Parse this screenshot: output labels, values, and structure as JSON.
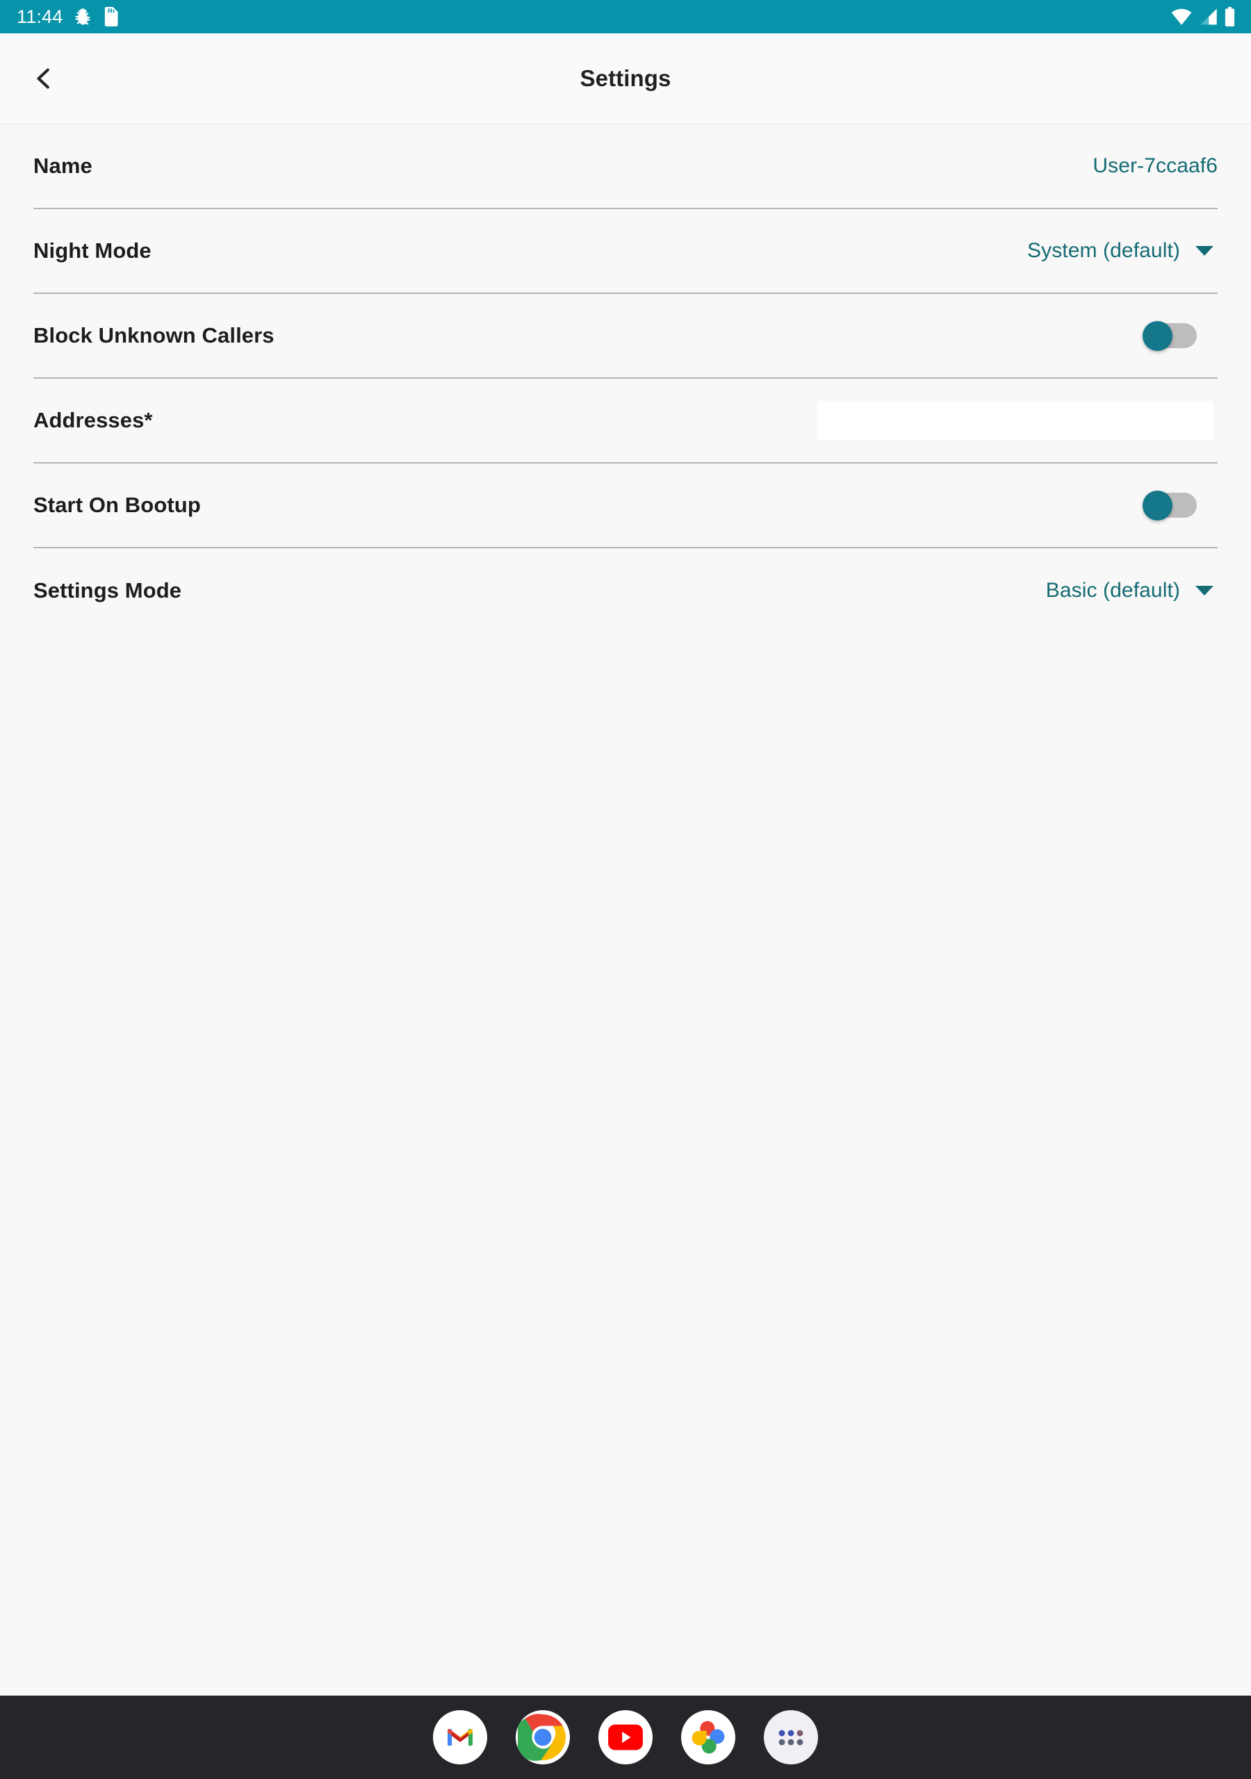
{
  "status_bar": {
    "time": "11:44",
    "background_color": "#0794ab",
    "icons": [
      "bug-icon",
      "sd-card-icon",
      "wifi-icon",
      "cellular-signal-icon",
      "battery-icon"
    ]
  },
  "app_bar": {
    "back_label": "‹",
    "title": "Settings"
  },
  "colors": {
    "accent": "#146b73",
    "toggle_thumb": "#15788a",
    "toggle_track": "#bdbdbd",
    "divider": "#b5b5b5",
    "background": "#f8f8f8",
    "dock": "#26262a"
  },
  "settings": {
    "rows": [
      {
        "label": "Name",
        "type": "text-value",
        "value": "User-7ccaaf6"
      },
      {
        "label": "Night Mode",
        "type": "dropdown",
        "value": "System (default)"
      },
      {
        "label": "Block Unknown Callers",
        "type": "toggle",
        "value": "off"
      },
      {
        "label": "Addresses*",
        "type": "input",
        "value": "",
        "placeholder": ""
      },
      {
        "label": "Start On Bootup",
        "type": "toggle",
        "value": "off"
      },
      {
        "label": "Settings Mode",
        "type": "dropdown",
        "value": "Basic (default)"
      }
    ]
  },
  "dock": {
    "apps": [
      {
        "name": "gmail-app-icon",
        "label": "Gmail"
      },
      {
        "name": "chrome-app-icon",
        "label": "Chrome"
      },
      {
        "name": "youtube-app-icon",
        "label": "YouTube"
      },
      {
        "name": "google-photos-app-icon",
        "label": "Photos"
      },
      {
        "name": "app-drawer-icon",
        "label": "All apps"
      }
    ]
  }
}
